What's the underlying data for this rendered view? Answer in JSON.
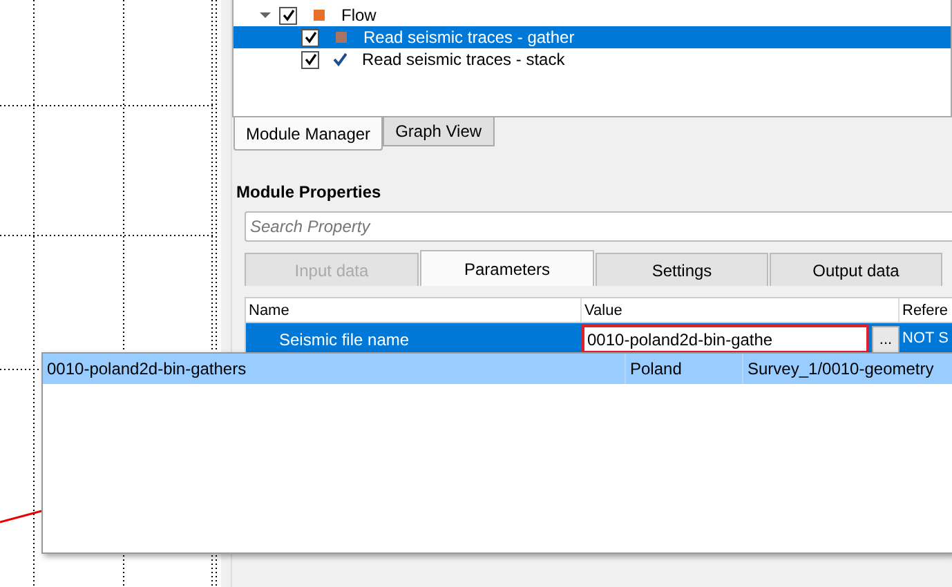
{
  "tree": {
    "items": [
      {
        "label": "Flow",
        "expanded": true,
        "checked": true,
        "color": "#e8702a",
        "children": [
          {
            "label": "Read seismic traces - gather",
            "checked": true,
            "selected": true,
            "kind": "square",
            "color": "#a87565"
          },
          {
            "label": "Read seismic traces - stack",
            "checked": true,
            "selected": false,
            "kind": "check"
          }
        ]
      }
    ]
  },
  "panel_tabs": [
    {
      "label": "Module Manager",
      "selected": true
    },
    {
      "label": "Graph View",
      "selected": false
    }
  ],
  "module_properties": {
    "title": "Module Properties",
    "search": {
      "placeholder": "Search Property"
    },
    "tabs": [
      {
        "label": "Input data",
        "selected": false,
        "disabled": true
      },
      {
        "label": "Parameters",
        "selected": true,
        "disabled": false
      },
      {
        "label": "Settings",
        "selected": false,
        "disabled": false
      },
      {
        "label": "Output data",
        "selected": false,
        "disabled": false
      }
    ],
    "table": {
      "columns": [
        "Name",
        "Value",
        "Refere"
      ],
      "rows": [
        {
          "name": "Seismic file name",
          "value": "0010-poland2d-bin-gathe",
          "highlighted": true,
          "browse": "...",
          "reference": "NOT S",
          "selected": true
        }
      ]
    }
  },
  "popup": {
    "rows": [
      {
        "cells": [
          "0010-poland2d-bin-gathers",
          "Poland",
          "Survey_1/0010-geometry"
        ],
        "selected": true
      }
    ]
  }
}
